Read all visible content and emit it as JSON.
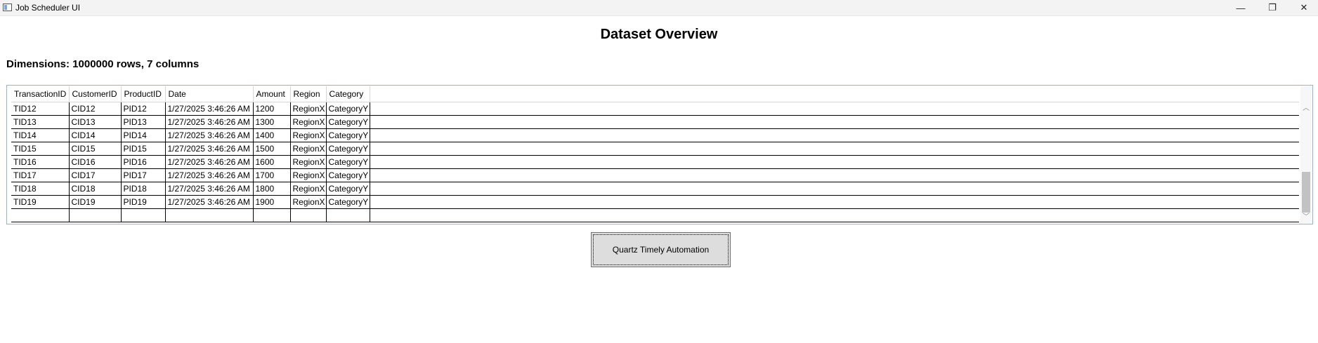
{
  "window": {
    "title": "Job Scheduler UI",
    "minimize_glyph": "—",
    "maximize_glyph": "❐",
    "close_glyph": "✕"
  },
  "page": {
    "title": "Dataset Overview",
    "dimensions_text": "Dimensions: 1000000 rows, 7 columns"
  },
  "grid": {
    "columns": [
      "TransactionID",
      "CustomerID",
      "ProductID",
      "Date",
      "Amount",
      "Region",
      "Category"
    ],
    "rows": [
      [
        "TID12",
        "CID12",
        "PID12",
        "1/27/2025 3:46:26 AM",
        "1200",
        "RegionX",
        "CategoryY"
      ],
      [
        "TID13",
        "CID13",
        "PID13",
        "1/27/2025 3:46:26 AM",
        "1300",
        "RegionX",
        "CategoryY"
      ],
      [
        "TID14",
        "CID14",
        "PID14",
        "1/27/2025 3:46:26 AM",
        "1400",
        "RegionX",
        "CategoryY"
      ],
      [
        "TID15",
        "CID15",
        "PID15",
        "1/27/2025 3:46:26 AM",
        "1500",
        "RegionX",
        "CategoryY"
      ],
      [
        "TID16",
        "CID16",
        "PID16",
        "1/27/2025 3:46:26 AM",
        "1600",
        "RegionX",
        "CategoryY"
      ],
      [
        "TID17",
        "CID17",
        "PID17",
        "1/27/2025 3:46:26 AM",
        "1700",
        "RegionX",
        "CategoryY"
      ],
      [
        "TID18",
        "CID18",
        "PID18",
        "1/27/2025 3:46:26 AM",
        "1800",
        "RegionX",
        "CategoryY"
      ],
      [
        "TID19",
        "CID19",
        "PID19",
        "1/27/2025 3:46:26 AM",
        "1900",
        "RegionX",
        "CategoryY"
      ],
      [
        "",
        "",
        "",
        "",
        "",
        "",
        ""
      ]
    ],
    "scroll_up_glyph": "︿",
    "scroll_down_glyph": "﹀"
  },
  "actions": {
    "automation_button_label": "Quartz Timely Automation"
  }
}
